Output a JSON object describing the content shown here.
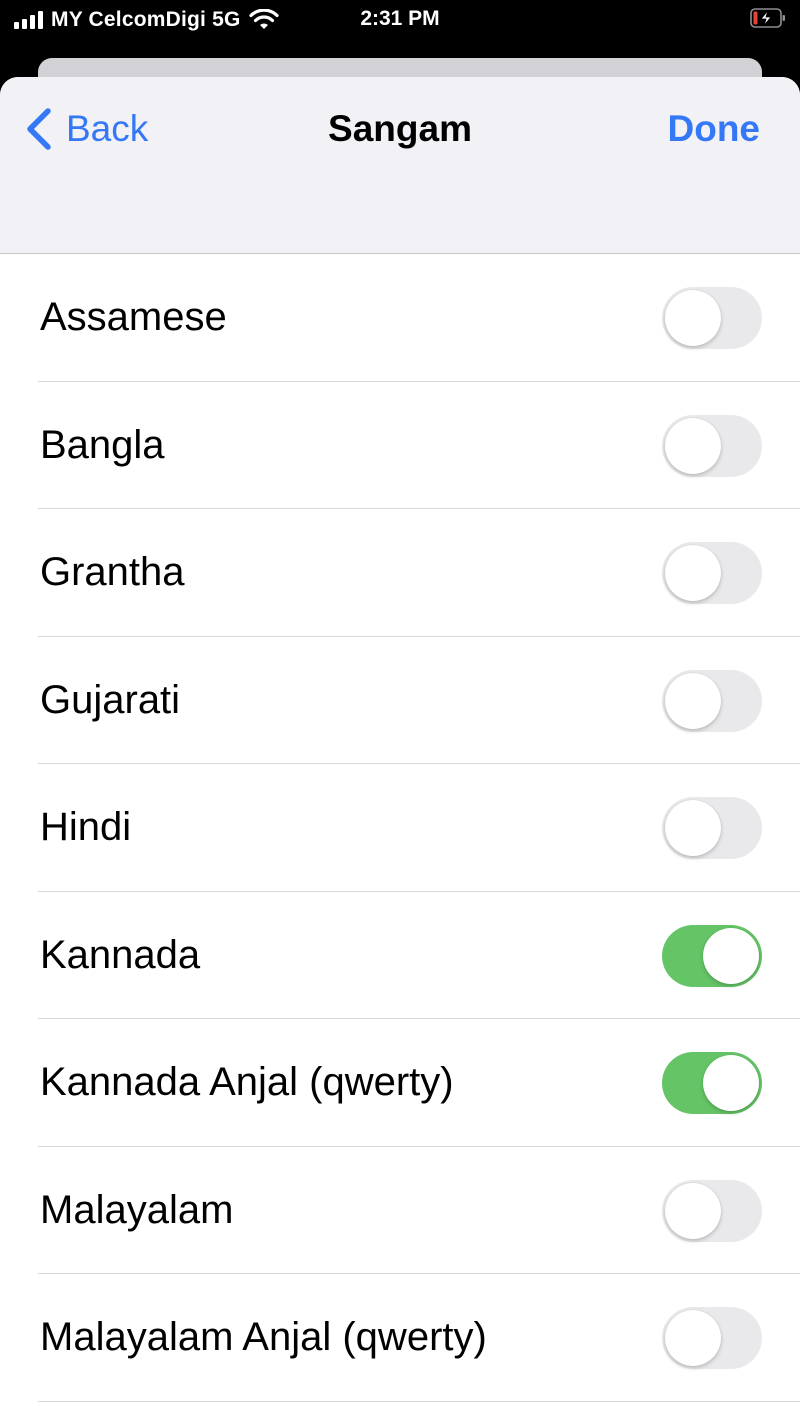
{
  "status_bar": {
    "carrier": "MY CelcomDigi 5G",
    "time": "2:31 PM"
  },
  "nav": {
    "back_label": "Back",
    "title": "Sangam",
    "done_label": "Done"
  },
  "colors": {
    "accent": "#3478f6",
    "toggle_on": "#65c466",
    "toggle_off": "#e9e9eb",
    "battery_low": "#e5443a"
  },
  "languages": [
    {
      "label": "Assamese",
      "enabled": false
    },
    {
      "label": "Bangla",
      "enabled": false
    },
    {
      "label": "Grantha",
      "enabled": false
    },
    {
      "label": "Gujarati",
      "enabled": false
    },
    {
      "label": "Hindi",
      "enabled": false
    },
    {
      "label": "Kannada",
      "enabled": true
    },
    {
      "label": "Kannada Anjal (qwerty)",
      "enabled": true
    },
    {
      "label": "Malayalam",
      "enabled": false
    },
    {
      "label": "Malayalam Anjal (qwerty)",
      "enabled": false
    }
  ]
}
